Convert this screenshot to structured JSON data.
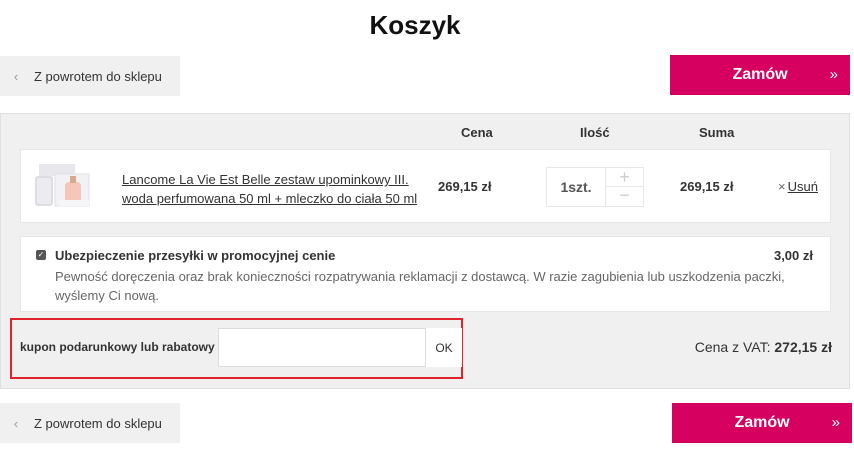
{
  "page": {
    "title": "Koszyk"
  },
  "nav": {
    "back_label": "Z powrotem do sklepu",
    "back_icon": "chevron-left-icon",
    "order_label": "Zamów",
    "order_icon": "double-chevron-right-icon"
  },
  "colors": {
    "accent": "#d5005f",
    "panel_bg": "#f0f0f0",
    "highlight": "#e0242e"
  },
  "table": {
    "headers": {
      "price": "Cena",
      "quantity": "Ilość",
      "sum": "Suma"
    }
  },
  "item": {
    "name": "Lancome La Vie Est Belle zestaw upominkowy III. woda perfumowana 50 ml + mleczko do ciała 50 ml",
    "price": "269,15 zł",
    "quantity": "1szt.",
    "plus": "+",
    "minus": "−",
    "sum": "269,15 zł",
    "remove_icon_glyph": "×",
    "remove_label": "Usuń"
  },
  "insurance": {
    "checked": true,
    "title": "Ubezpieczenie przesyłki w promocyjnej cenie",
    "price": "3,00 zł",
    "description": "Pewność doręczenia oraz brak konieczności rozpatrywania reklamacji z dostawcą. W razie zagubienia lub uszkodzenia paczki, wyślemy Ci nową."
  },
  "coupon": {
    "label": "kupon podarunkowy lub rabatowy",
    "value": "",
    "placeholder": "",
    "ok_label": "OK"
  },
  "total": {
    "label": "Cena z VAT:",
    "value": "272,15 zł"
  }
}
